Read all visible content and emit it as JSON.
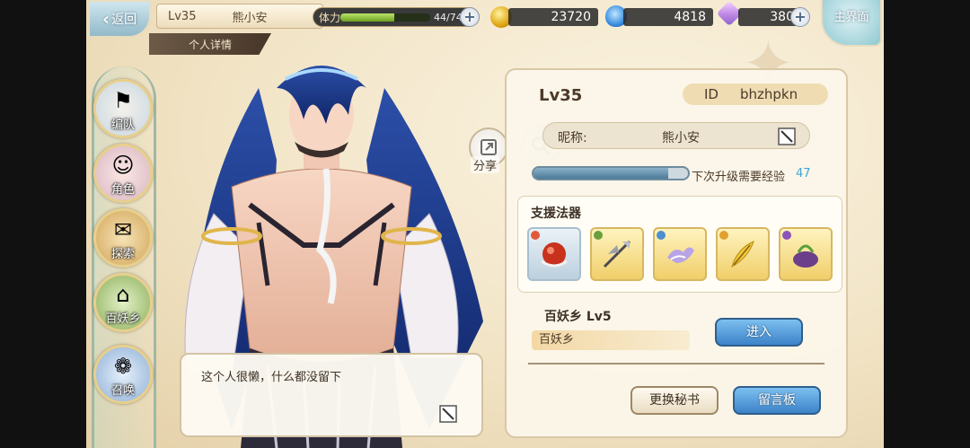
{
  "topbar": {
    "back_label": "返回",
    "level": "Lv35",
    "player_name": "熊小安",
    "subtitle": "个人详情",
    "stamina_label": "体力",
    "stamina_value": "44/74",
    "stamina_fraction": 0.595,
    "gold": "23720",
    "spirit": "4818",
    "crystal": "380",
    "home_label": "主界面",
    "plus_symbol": "+"
  },
  "sidebar": {
    "items": [
      {
        "label": "编队",
        "icon": "team-formation-icon"
      },
      {
        "label": "角色",
        "icon": "character-icon"
      },
      {
        "label": "探索",
        "icon": "explore-icon"
      },
      {
        "label": "百妖乡",
        "icon": "village-icon"
      },
      {
        "label": "召唤",
        "icon": "summon-icon"
      }
    ]
  },
  "character": {
    "share_label": "分享",
    "bio": "这个人很懒，什么都没留下"
  },
  "profile": {
    "level": "Lv35",
    "id_label": "ID",
    "id_value": "bhzhpkn",
    "nickname_label": "昵称:",
    "nickname_value": "熊小安",
    "exp_label": "下次升级需要经验",
    "exp_value": "47",
    "exp_fraction": 0.87,
    "support_title": "支援法器",
    "support_items": [
      {
        "icon": "red-orb-artifact-icon",
        "gem_color": "#e2593a"
      },
      {
        "icon": "halberd-artifact-icon",
        "gem_color": "#6aa03c"
      },
      {
        "icon": "wind-cloud-artifact-icon",
        "gem_color": "#4d8fcf"
      },
      {
        "icon": "golden-feather-artifact-icon",
        "gem_color": "#e0a12e"
      },
      {
        "icon": "purple-bowl-artifact-icon",
        "gem_color": "#8c55b8"
      }
    ],
    "base_title": "百妖乡 Lv5",
    "base_name": "百妖乡",
    "enter_label": "进入",
    "secretary_label": "更换秘书",
    "board_label": "留言板"
  },
  "colors": {
    "accent_blue": "#3c82c8",
    "panel_bg": "#fbf6e9",
    "gold_border": "#d7b760"
  }
}
